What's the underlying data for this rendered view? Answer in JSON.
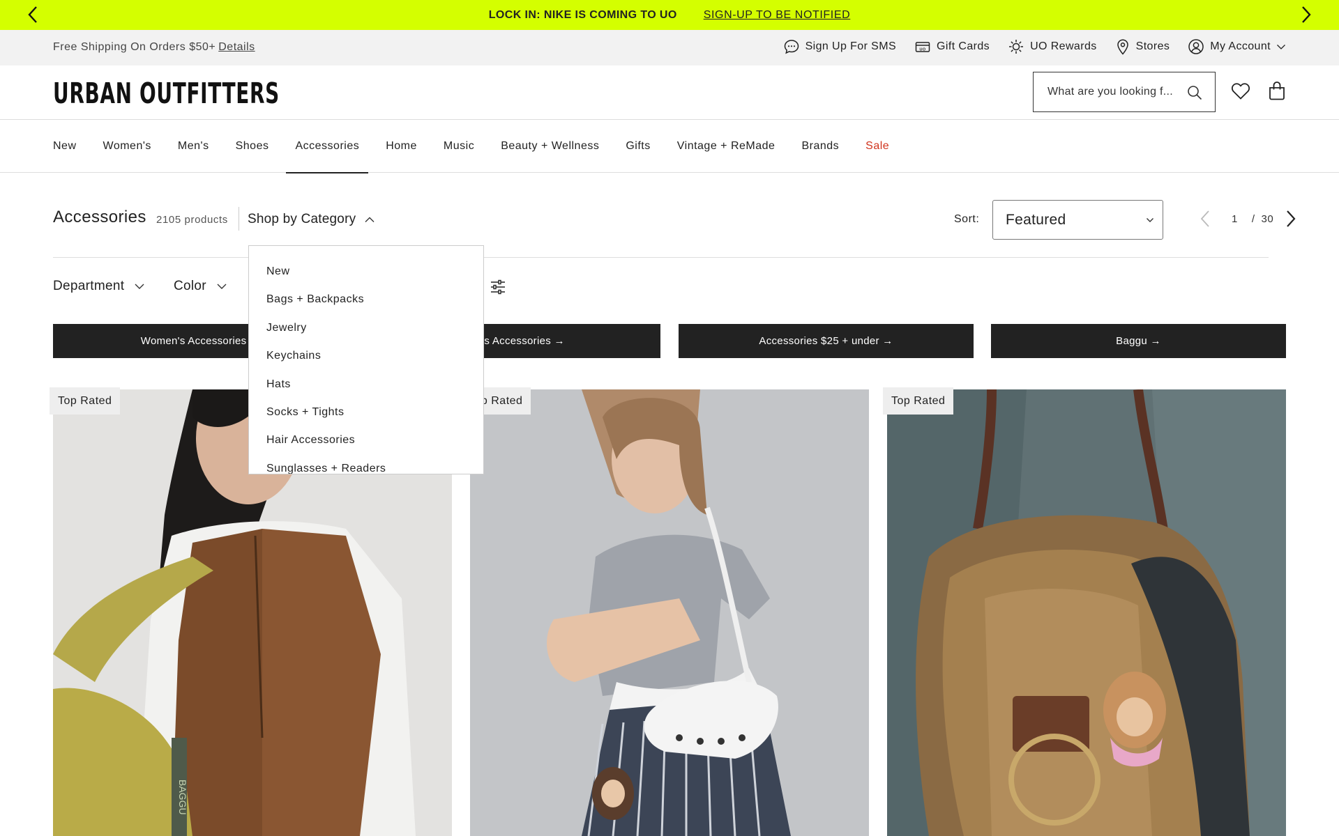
{
  "promo": {
    "message": "LOCK IN: NIKE IS COMING TO UO",
    "link": "SIGN-UP TO BE NOTIFIED"
  },
  "utility": {
    "shipping": "Free Shipping On Orders $50+",
    "details": "Details",
    "links": [
      "Sign Up For SMS",
      "Gift Cards",
      "UO Rewards",
      "Stores",
      "My Account"
    ]
  },
  "header": {
    "logo": "URBAN OUTFITTERS",
    "search_placeholder": "What are you looking f..."
  },
  "nav": [
    "New",
    "Women's",
    "Men's",
    "Shoes",
    "Accessories",
    "Home",
    "Music",
    "Beauty + Wellness",
    "Gifts",
    "Vintage + ReMade",
    "Brands",
    "Sale"
  ],
  "toolbar": {
    "title": "Accessories",
    "count": "2105 products",
    "shop_by_category": "Shop by Category",
    "sort_label": "Sort:",
    "sort_value": "Featured",
    "page_current": "1",
    "page_sep": "/",
    "page_total": "30"
  },
  "filters": {
    "department": "Department",
    "color": "Color"
  },
  "categories": [
    "Women's Accessories →",
    "Men's Accessories →",
    "Accessories $25 + under →",
    "Baggu →"
  ],
  "dropdown": [
    "New",
    "Bags + Backpacks",
    "Jewelry",
    "Keychains",
    "Hats",
    "Socks + Tights",
    "Hair Accessories",
    "Sunglasses + Readers"
  ],
  "products": [
    {
      "badge": "Top Rated"
    },
    {
      "badge": "Top Rated"
    },
    {
      "badge": "Top Rated"
    }
  ],
  "colors": {
    "promo_bg": "#d4ff00",
    "sale": "#d0331d",
    "banner_bg": "#222222"
  }
}
